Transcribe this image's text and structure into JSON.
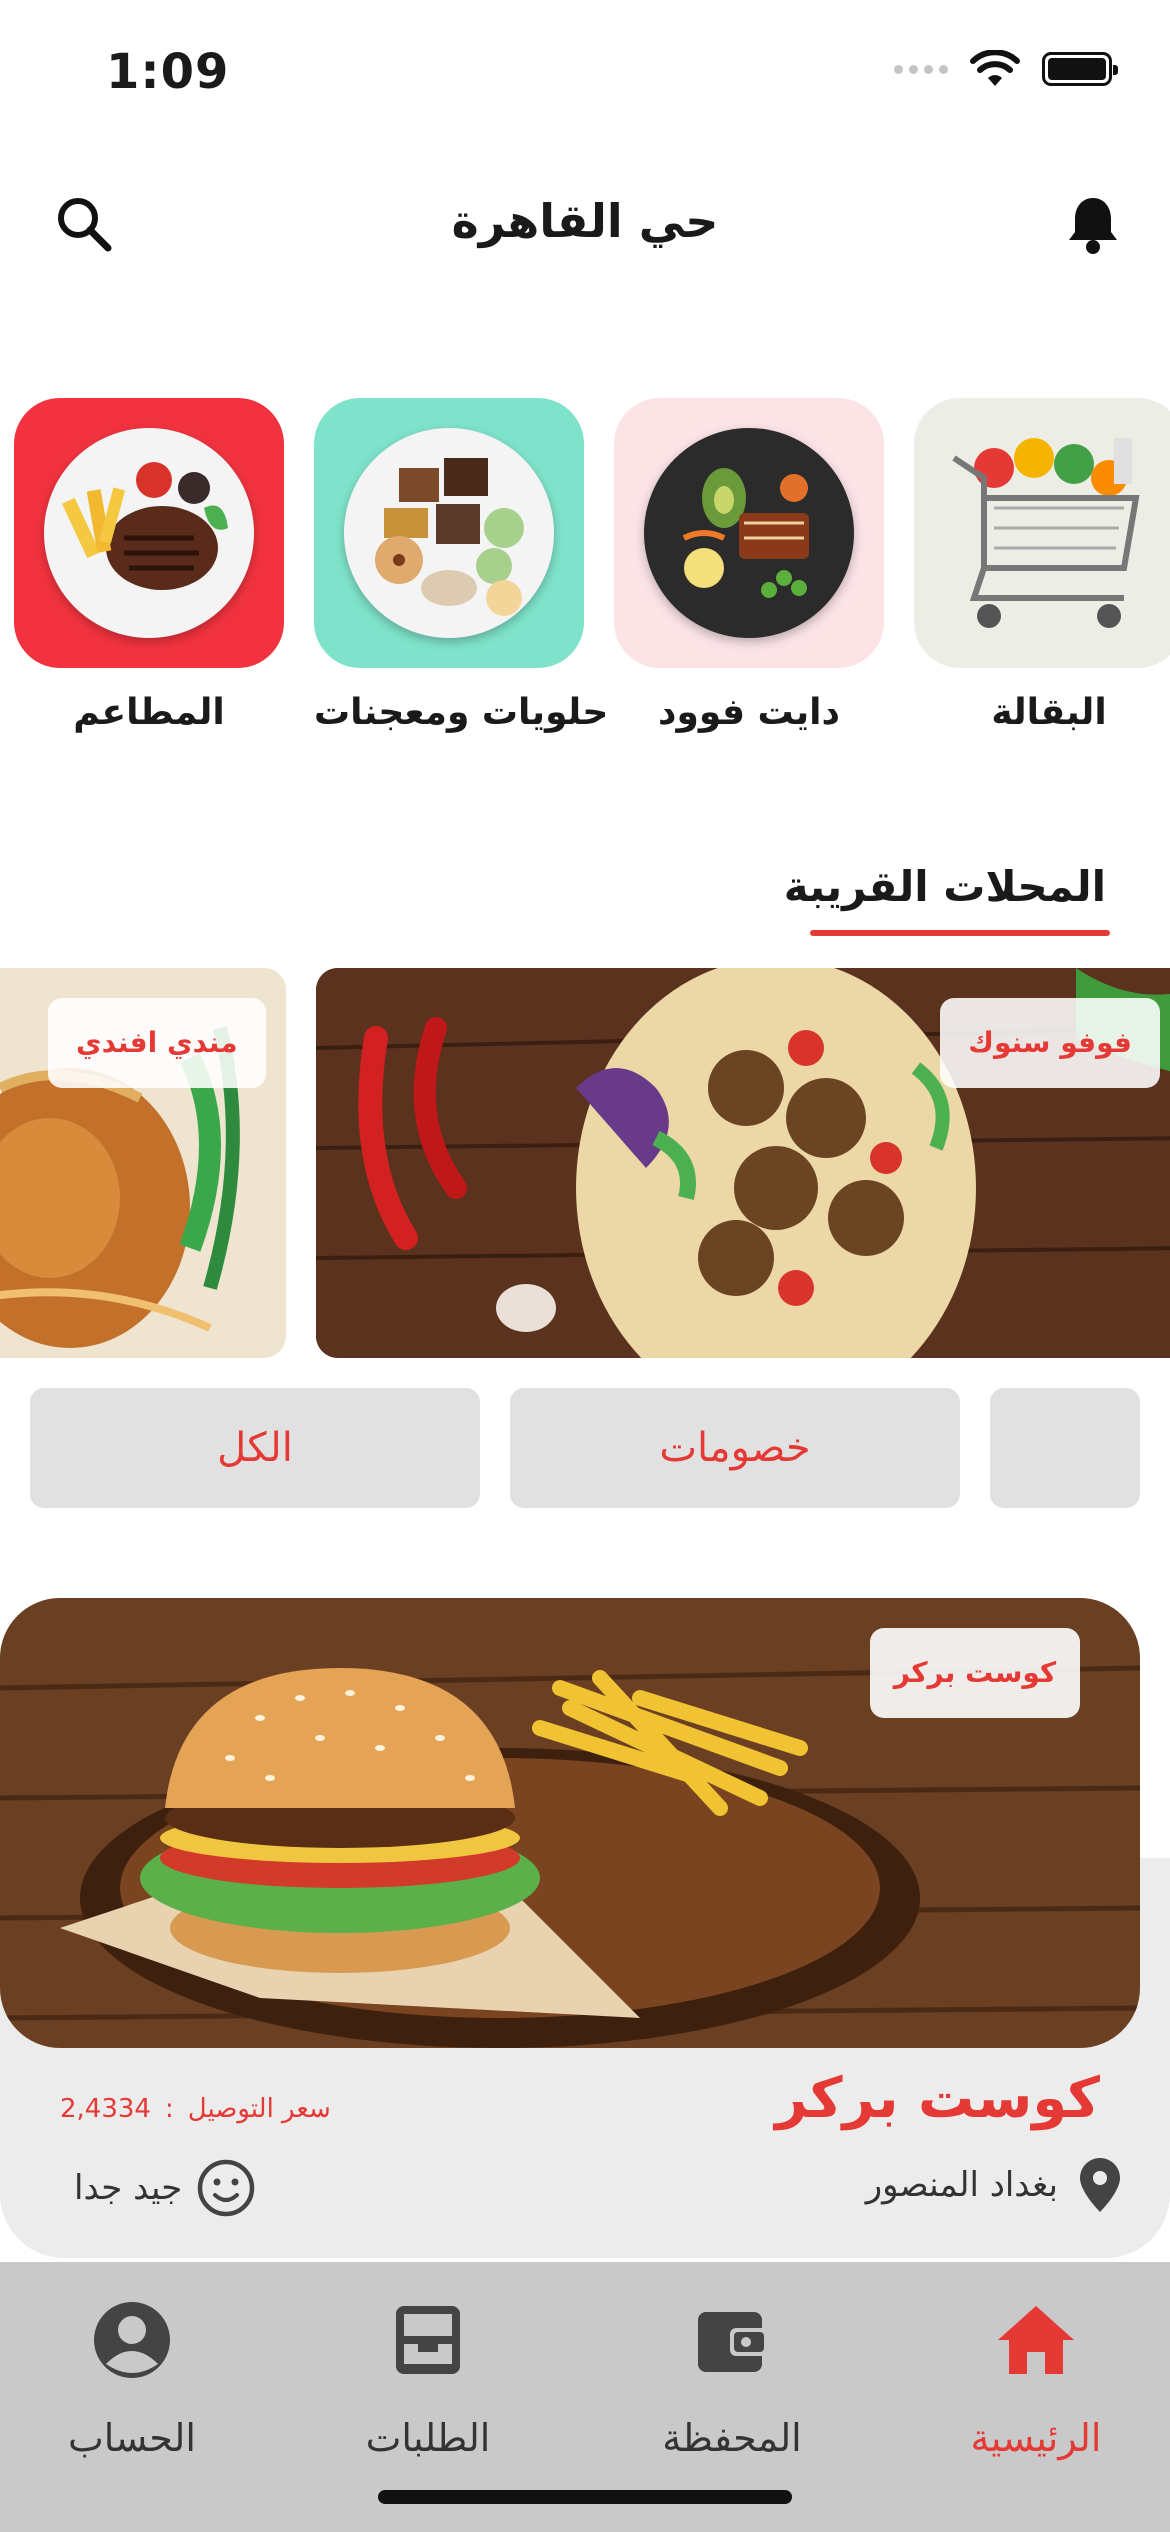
{
  "status_bar": {
    "time": "1:09"
  },
  "header": {
    "title": "حي القاهرة",
    "search_icon": "search-icon",
    "bell_icon": "bell-icon"
  },
  "categories": [
    {
      "label": "المطاعم",
      "bg": "#f2333f"
    },
    {
      "label": "حلويات ومعجنات",
      "bg": "#7fe3cb"
    },
    {
      "label": "دايت فوود",
      "bg": "#fbe3e6"
    },
    {
      "label": "البقالة",
      "bg": "#eceee6"
    }
  ],
  "nearby": {
    "title": "المحلات القريبة",
    "shops": [
      {
        "name": "مندي افندي"
      },
      {
        "name": "فوفو سنوك"
      }
    ]
  },
  "filters": [
    {
      "label": "الكل"
    },
    {
      "label": "خصومات"
    },
    {
      "label": ""
    }
  ],
  "featured": {
    "tag": "كوست بركر",
    "name": "كوست بركر",
    "delivery_label": "سعر التوصيل",
    "delivery_separator": ":",
    "delivery_price": "2,4334",
    "location": "بغداد المنصور",
    "rating": "جيد جدا"
  },
  "tabbar": {
    "items": [
      {
        "label": "الرئيسية",
        "icon": "home-icon",
        "active": true
      },
      {
        "label": "المحفظة",
        "icon": "wallet-icon",
        "active": false
      },
      {
        "label": "الطلبات",
        "icon": "orders-icon",
        "active": false
      },
      {
        "label": "الحساب",
        "icon": "account-icon",
        "active": false
      }
    ]
  },
  "colors": {
    "accent": "#e53935",
    "tabbar_bg": "#c9c9c9",
    "card_bg": "#ececec",
    "chip_bg": "#e2e1e1"
  }
}
